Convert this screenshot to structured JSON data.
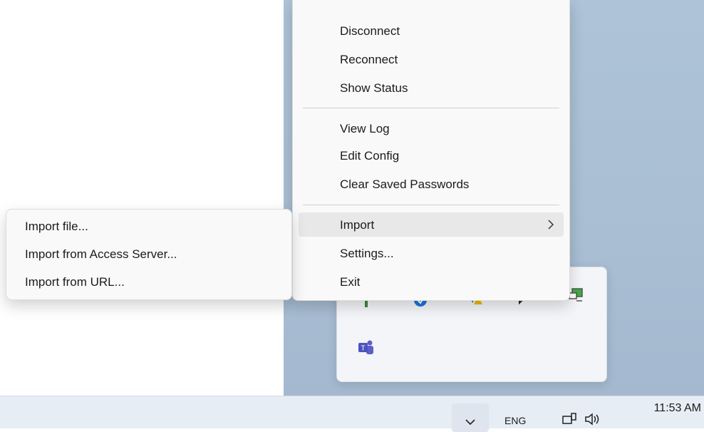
{
  "context_menu": {
    "items": [
      {
        "label": "Disconnect"
      },
      {
        "label": "Reconnect"
      },
      {
        "label": "Show Status"
      },
      {
        "label": "View Log"
      },
      {
        "label": "Edit Config"
      },
      {
        "label": "Clear Saved Passwords"
      },
      {
        "label": "Import"
      },
      {
        "label": "Settings..."
      },
      {
        "label": "Exit"
      }
    ],
    "highlighted_item": "Import"
  },
  "import_submenu": {
    "items": [
      {
        "label": "Import file..."
      },
      {
        "label": "Import from Access Server..."
      },
      {
        "label": "Import from URL..."
      }
    ]
  },
  "tray_flyout": {
    "icons": [
      "network-tray-icon",
      "blue-circle-app-icon",
      "warning-shield-icon",
      "chat-icon",
      "monitor-connected-icon",
      "teams-icon"
    ]
  },
  "taskbar": {
    "language": "ENG",
    "time": "11:53 AM"
  },
  "colors": {
    "menu_bg": "#f9f9f9",
    "highlight": "#e8e8e8",
    "wallpaper": "#aec3d8",
    "taskbar": "#e7edf5"
  }
}
